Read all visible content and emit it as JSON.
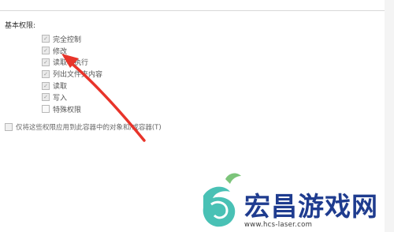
{
  "section_title": "基本权限:",
  "permissions": [
    {
      "label": "完全控制",
      "checked": true
    },
    {
      "label": "修改",
      "checked": true
    },
    {
      "label": "读取和执行",
      "checked": true
    },
    {
      "label": "列出文件夹内容",
      "checked": true
    },
    {
      "label": "读取",
      "checked": true
    },
    {
      "label": "写入",
      "checked": true
    },
    {
      "label": "特殊权限",
      "checked": false
    }
  ],
  "apply_option": {
    "label": "仅将这些权限应用到此容器中的对象和/或容器(T)",
    "checked": false
  },
  "watermark": {
    "text": "宏昌游戏网",
    "url": "www.hcs-laser.com",
    "color": "#1f3c8f"
  },
  "annotation": {
    "color": "#e8342a",
    "icon": "red-arrow-icon"
  }
}
